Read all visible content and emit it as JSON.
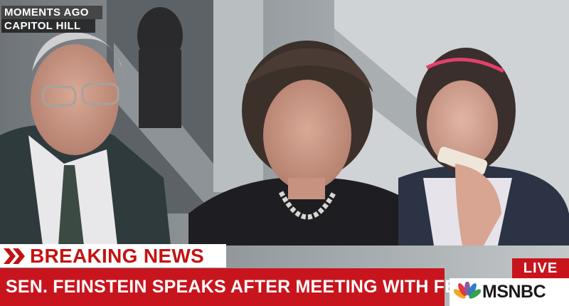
{
  "bug": {
    "line1": "MOMENTS AGO",
    "line2": "CAPITOL HILL"
  },
  "lower_third": {
    "breaking_label": "BREAKING NEWS",
    "headline": "SEN. FEINSTEIN SPEAKS AFTER MEETING WITH FBI DIRECTOR"
  },
  "live_label": "LIVE",
  "network_name": "MSNBC",
  "colors": {
    "accent_red": "#c8151d",
    "breaking_red": "#c41212",
    "bug_bg": "#3c3c3c"
  },
  "icons": [
    "double-chevron-icon",
    "peacock-logo-icon"
  ]
}
